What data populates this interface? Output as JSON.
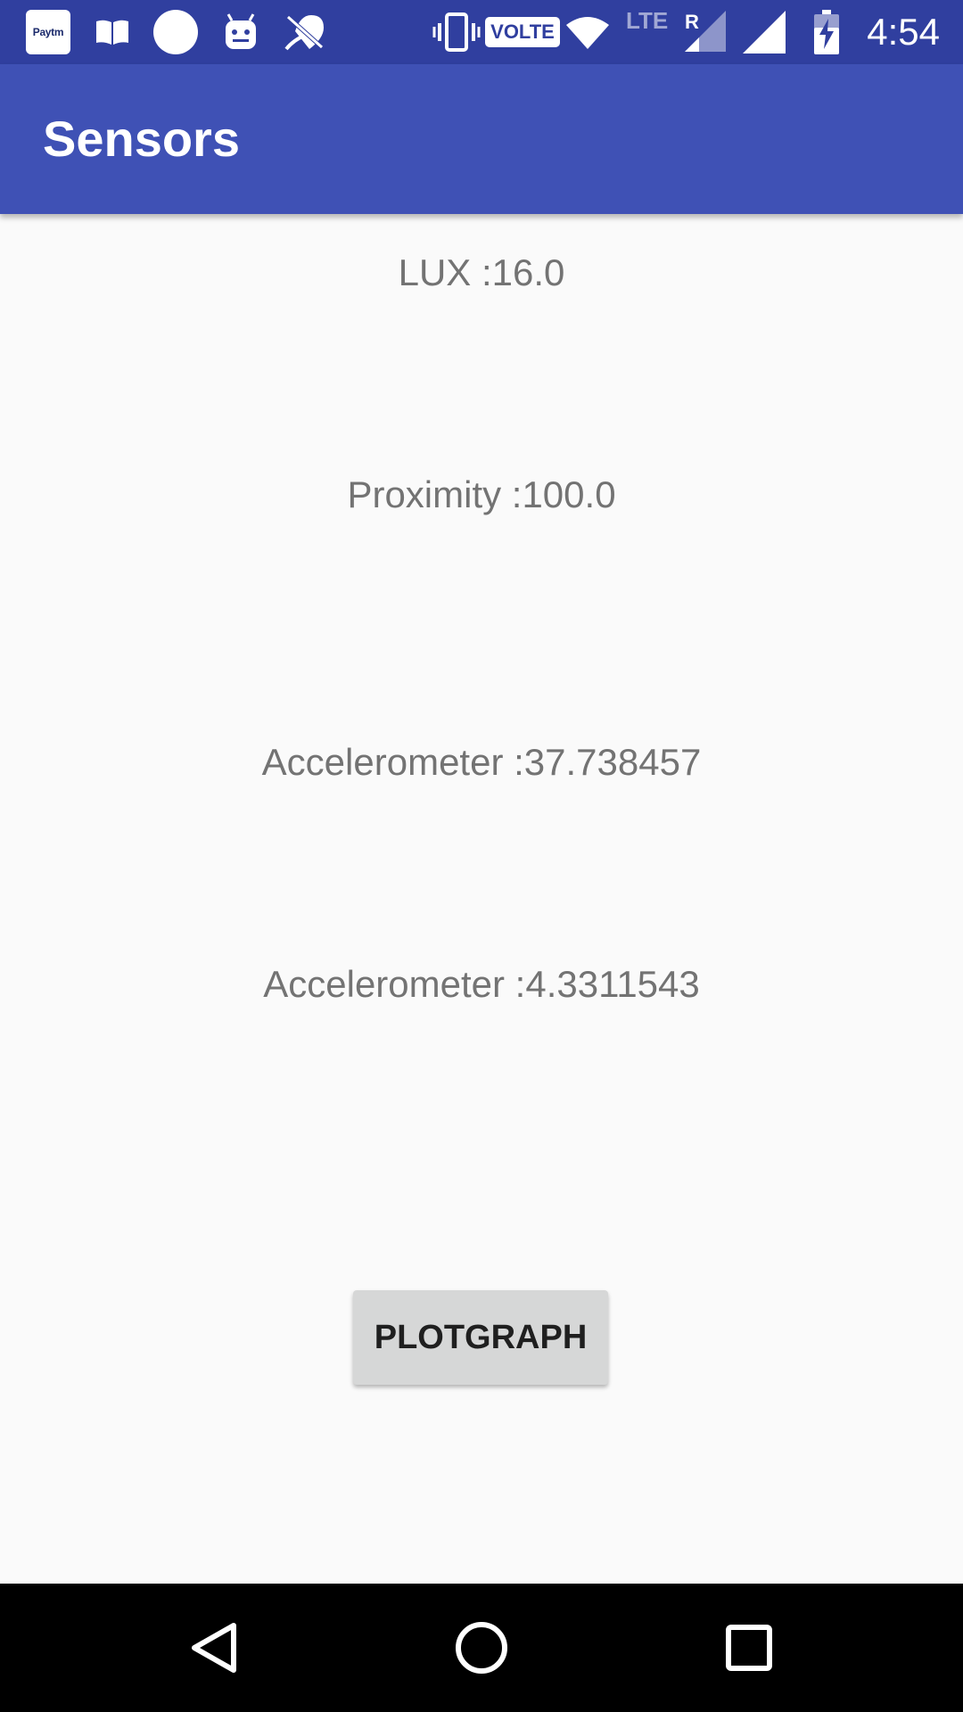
{
  "status_bar": {
    "time": "4:54",
    "paytm_label": "Paytm",
    "volte_label": "VOLTE",
    "lte_label": "LTE",
    "roaming_label": "R",
    "icons": [
      "paytm-icon",
      "book-icon",
      "circle-icon",
      "android-icon",
      "no-location-icon",
      "vibrate-icon",
      "volte-icon",
      "wifi-icon",
      "signal-icon",
      "signal-icon",
      "battery-charging-icon"
    ]
  },
  "app_bar": {
    "title": "Sensors",
    "color": "#3f51b5"
  },
  "readings": {
    "lux": "LUX :16.0",
    "proximity": "Proximity :100.0",
    "accelerometer_1": "Accelerometer :37.738457",
    "accelerometer_2": "Accelerometer :4.3311543"
  },
  "actions": {
    "plot_graph_label": "PLOTGRAPH"
  },
  "nav_bar": {
    "icons": [
      "back-icon",
      "home-icon",
      "recents-icon"
    ]
  }
}
